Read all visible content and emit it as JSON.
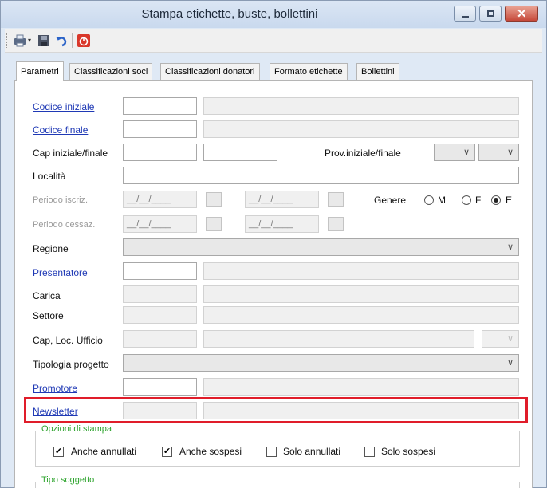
{
  "window": {
    "title": "Stampa etichette, buste, bollettini"
  },
  "tabs": [
    "Parametri",
    "Classificazioni soci",
    "Classificazioni donatori",
    "Formato etichette",
    "Bollettini"
  ],
  "labels": {
    "codice_iniziale": "Codice iniziale",
    "codice_finale": "Codice finale",
    "cap": "Cap iniziale/finale",
    "prov": "Prov.iniziale/finale",
    "localita": "Località",
    "periodo_iscriz": "Periodo iscriz.",
    "periodo_cessaz": "Periodo cessaz.",
    "genere": "Genere",
    "regione": "Regione",
    "presentatore": "Presentatore",
    "carica": "Carica",
    "settore": "Settore",
    "cap_loc_ufficio": "Cap, Loc. Ufficio",
    "tipologia_progetto": "Tipologia progetto",
    "promotore": "Promotore",
    "newsletter": "Newsletter"
  },
  "date_placeholder": "__/__/____",
  "genere_options": [
    {
      "label": "M",
      "selected": false
    },
    {
      "label": "F",
      "selected": false
    },
    {
      "label": "E",
      "selected": true
    }
  ],
  "opzioni_stampa": {
    "title": "Opzioni di stampa",
    "items": [
      {
        "label": "Anche annullati",
        "checked": true
      },
      {
        "label": "Anche sospesi",
        "checked": true
      },
      {
        "label": "Solo annullati",
        "checked": false
      },
      {
        "label": "Solo sospesi",
        "checked": false
      }
    ]
  },
  "tipo_soggetto": {
    "title": "Tipo soggetto"
  },
  "glyphs": {
    "chevron": "∨",
    "check": "✔"
  },
  "colors": {
    "link": "#1f39b5",
    "highlight": "#e01d2a",
    "group_title": "#2ea42e"
  }
}
